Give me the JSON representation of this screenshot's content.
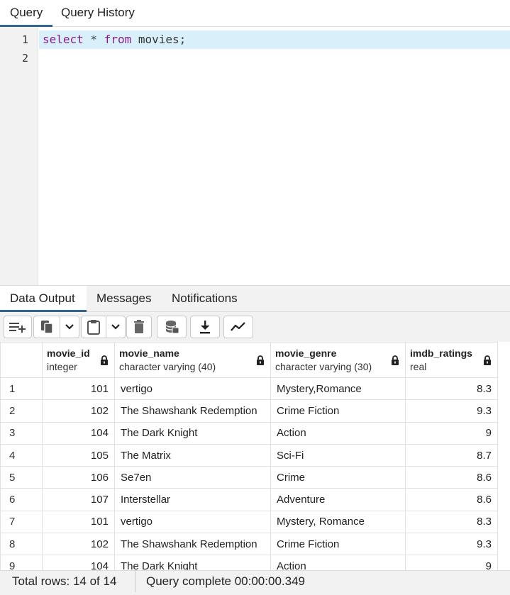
{
  "tabs": {
    "query": "Query",
    "history": "Query History"
  },
  "editor": {
    "line_numbers": [
      "1",
      "2"
    ],
    "line1": {
      "kw1": "select",
      "op": " * ",
      "kw2": "from",
      "rest": " movies;"
    }
  },
  "output_tabs": {
    "data": "Data Output",
    "messages": "Messages",
    "notifications": "Notifications"
  },
  "toolbar": {
    "icons": [
      "add-row-icon",
      "copy-icon",
      "chevron-down-icon",
      "paste-icon",
      "chevron-down-icon",
      "delete-icon",
      "save-data-icon",
      "download-icon",
      "graph-icon"
    ]
  },
  "columns": [
    {
      "name": "movie_id",
      "type": "integer"
    },
    {
      "name": "movie_name",
      "type": "character varying (40)"
    },
    {
      "name": "movie_genre",
      "type": "character varying (30)"
    },
    {
      "name": "imdb_ratings",
      "type": "real"
    }
  ],
  "rows": [
    [
      "1",
      "101",
      "vertigo",
      "Mystery,Romance",
      "8.3"
    ],
    [
      "2",
      "102",
      "The Shawshank Redemption",
      "Crime Fiction",
      "9.3"
    ],
    [
      "3",
      "104",
      "The Dark Knight",
      "Action",
      "9"
    ],
    [
      "4",
      "105",
      "The Matrix",
      "Sci-Fi",
      "8.7"
    ],
    [
      "5",
      "106",
      "Se7en",
      "Crime",
      "8.6"
    ],
    [
      "6",
      "107",
      "Interstellar",
      "Adventure",
      "8.6"
    ],
    [
      "7",
      "101",
      "vertigo",
      "Mystery, Romance",
      "8.3"
    ],
    [
      "8",
      "102",
      "The Shawshank Redemption",
      "Crime Fiction",
      "9.3"
    ],
    [
      "9",
      "104",
      "The Dark Knight",
      "Action",
      "9"
    ]
  ],
  "status": {
    "rows": "Total rows: 14 of 14",
    "time": "Query complete 00:00:00.349"
  },
  "colors": {
    "accent": "#326690",
    "keyword": "#8a1a8a",
    "line_highlight": "#d9f0fb"
  }
}
